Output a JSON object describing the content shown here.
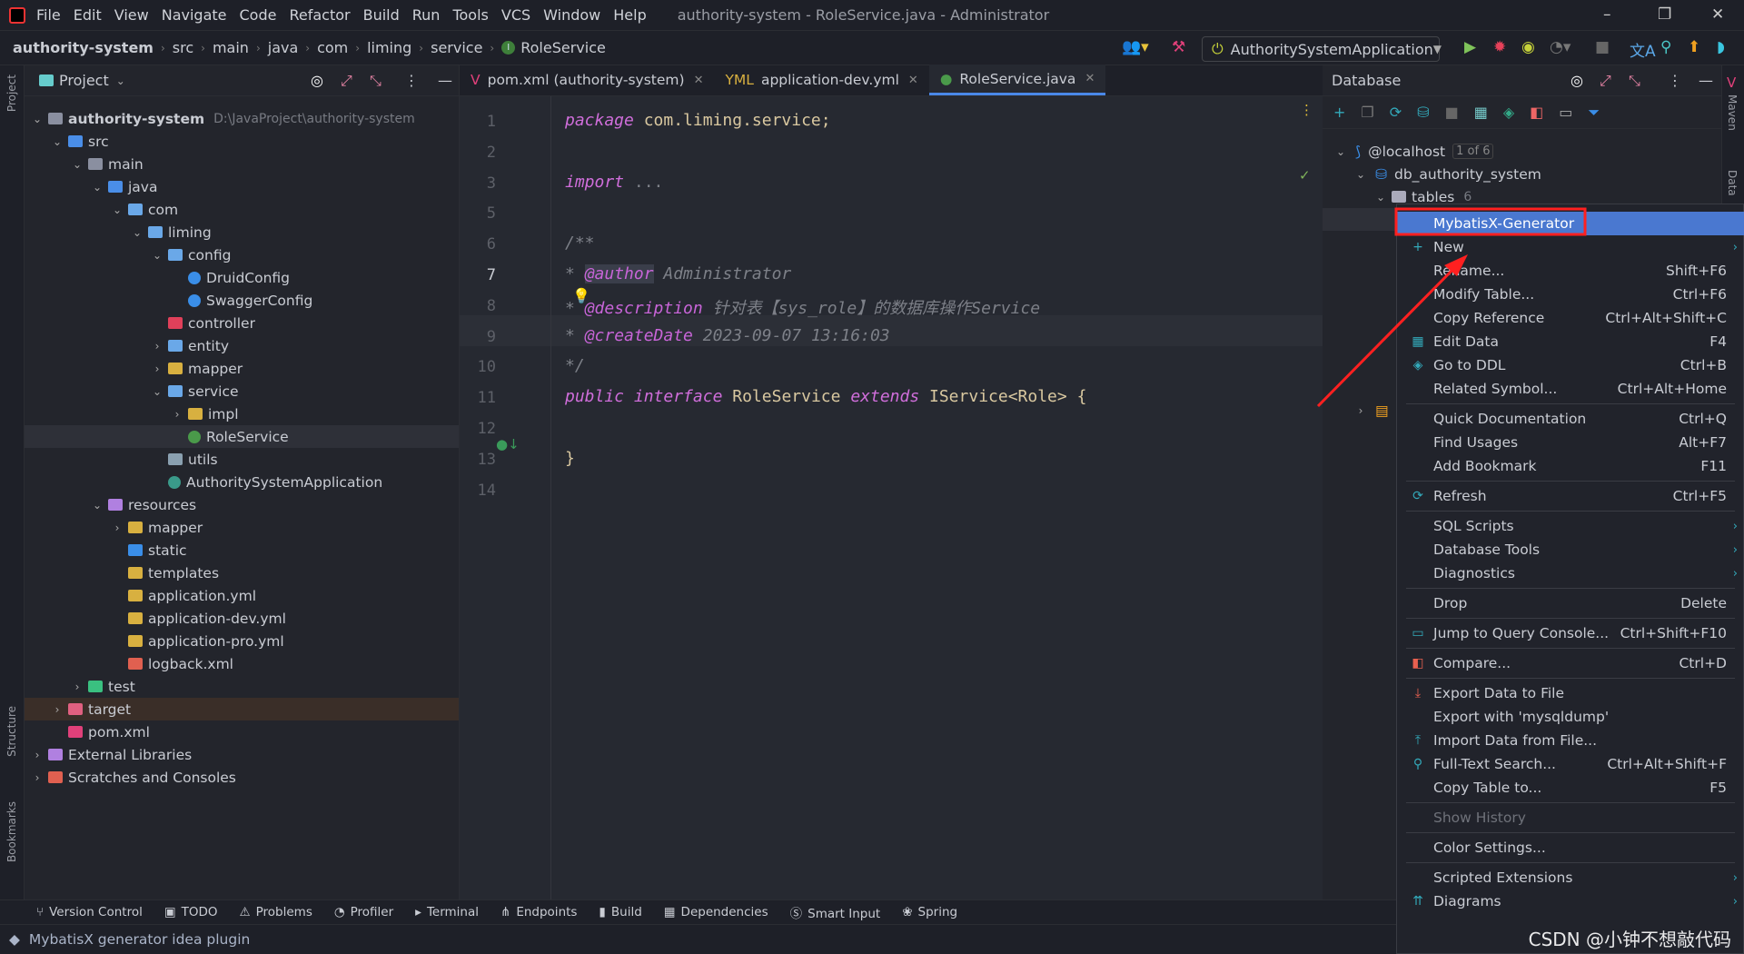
{
  "window": {
    "title": "authority-system - RoleService.java - Administrator"
  },
  "menu": [
    "File",
    "Edit",
    "View",
    "Navigate",
    "Code",
    "Refactor",
    "Build",
    "Run",
    "Tools",
    "VCS",
    "Window",
    "Help"
  ],
  "breadcrumb": [
    "authority-system",
    "src",
    "main",
    "java",
    "com",
    "liming",
    "service",
    "RoleService"
  ],
  "run_config": "AuthoritySystemApplication",
  "left_strip": [
    "Project",
    "Structure",
    "Bookmarks"
  ],
  "right_strip": [
    "Maven",
    "Data"
  ],
  "project": {
    "title": "Project",
    "tree": [
      {
        "d": 0,
        "c": "v",
        "t": "dir",
        "label": "authority-system",
        "hint": "D:\\JavaProject\\authority-system",
        "bold": true
      },
      {
        "d": 1,
        "c": "v",
        "t": "src",
        "label": "src"
      },
      {
        "d": 2,
        "c": "v",
        "t": "dir",
        "label": "main"
      },
      {
        "d": 3,
        "c": "v",
        "t": "src",
        "label": "java"
      },
      {
        "d": 4,
        "c": "v",
        "t": "pkg",
        "label": "com"
      },
      {
        "d": 5,
        "c": "v",
        "t": "pkg",
        "label": "liming"
      },
      {
        "d": 6,
        "c": "v",
        "t": "pkg",
        "label": "config"
      },
      {
        "d": 7,
        "c": "",
        "t": "class",
        "label": "DruidConfig"
      },
      {
        "d": 7,
        "c": "",
        "t": "class",
        "label": "SwaggerConfig"
      },
      {
        "d": 6,
        "c": "",
        "t": "pkgr",
        "label": "controller"
      },
      {
        "d": 6,
        "c": ">",
        "t": "pkg",
        "label": "entity"
      },
      {
        "d": 6,
        "c": ">",
        "t": "pkgy",
        "label": "mapper"
      },
      {
        "d": 6,
        "c": "v",
        "t": "pkg",
        "label": "service"
      },
      {
        "d": 7,
        "c": ">",
        "t": "pkgy",
        "label": "impl"
      },
      {
        "d": 7,
        "c": "",
        "t": "iface",
        "label": "RoleService",
        "sel": true
      },
      {
        "d": 6,
        "c": "",
        "t": "pkgg",
        "label": "utils"
      },
      {
        "d": 6,
        "c": "",
        "t": "app",
        "label": "AuthoritySystemApplication"
      },
      {
        "d": 3,
        "c": "v",
        "t": "res",
        "label": "resources"
      },
      {
        "d": 4,
        "c": ">",
        "t": "pkgy",
        "label": "mapper"
      },
      {
        "d": 4,
        "c": "",
        "t": "web",
        "label": "static"
      },
      {
        "d": 4,
        "c": "",
        "t": "pkgy",
        "label": "templates"
      },
      {
        "d": 4,
        "c": "",
        "t": "yml",
        "label": "application.yml"
      },
      {
        "d": 4,
        "c": "",
        "t": "yml",
        "label": "application-dev.yml"
      },
      {
        "d": 4,
        "c": "",
        "t": "yml",
        "label": "application-pro.yml"
      },
      {
        "d": 4,
        "c": "",
        "t": "xml",
        "label": "logback.xml"
      },
      {
        "d": 2,
        "c": ">",
        "t": "test",
        "label": "test"
      },
      {
        "d": 1,
        "c": ">",
        "t": "target",
        "label": "target",
        "tgt": true
      },
      {
        "d": 1,
        "c": "",
        "t": "pom",
        "label": "pom.xml"
      },
      {
        "d": 0,
        "c": ">",
        "t": "lib",
        "label": "External Libraries"
      },
      {
        "d": 0,
        "c": ">",
        "t": "scr",
        "label": "Scratches and Consoles"
      }
    ]
  },
  "editor": {
    "tabs": [
      {
        "label": "pom.xml (authority-system)",
        "icon": "maven-icon"
      },
      {
        "label": "application-dev.yml",
        "icon": "yaml-icon"
      },
      {
        "label": "RoleService.java",
        "icon": "interface-icon",
        "active": true
      }
    ],
    "lines": [
      {
        "n": "1",
        "seg": [
          [
            "kw",
            "package"
          ],
          [
            "pl",
            " com.liming.service;"
          ]
        ]
      },
      {
        "n": "2",
        "seg": []
      },
      {
        "n": "3",
        "seg": [
          [
            "kw",
            "import"
          ],
          [
            "fold",
            " ..."
          ]
        ]
      },
      {
        "n": "5",
        "seg": []
      },
      {
        "n": "6",
        "seg": [
          [
            "cm",
            "/**"
          ]
        ]
      },
      {
        "n": "7",
        "seg": [
          [
            "cm",
            "* "
          ],
          [
            "tag",
            "@author"
          ],
          [
            "cm",
            " Administrator"
          ]
        ]
      },
      {
        "n": "8",
        "seg": [
          [
            "cm",
            "* "
          ],
          [
            "tag",
            "@description"
          ],
          [
            "cm",
            " 针对表【sys_role】的数据库操作Service"
          ]
        ]
      },
      {
        "n": "9",
        "seg": [
          [
            "cm",
            "* "
          ],
          [
            "tag",
            "@createDate"
          ],
          [
            "cm",
            " 2023-09-07 13:16:03"
          ]
        ]
      },
      {
        "n": "10",
        "seg": [
          [
            "cm",
            "*/"
          ]
        ]
      },
      {
        "n": "11",
        "seg": [
          [
            "kw",
            "public"
          ],
          [
            "pl",
            " "
          ],
          [
            "kw",
            "interface"
          ],
          [
            "pl",
            " RoleService "
          ],
          [
            "kw",
            "extends"
          ],
          [
            "pl",
            " IService<Role> {"
          ]
        ]
      },
      {
        "n": "12",
        "seg": []
      },
      {
        "n": "13",
        "seg": [
          [
            "pl",
            "}"
          ]
        ]
      },
      {
        "n": "14",
        "seg": []
      }
    ]
  },
  "database": {
    "title": "Database",
    "host": "@localhost",
    "host_badge": "1 of 6",
    "schema": "db_authority_system",
    "tables": "tables",
    "tables_count": "6"
  },
  "context_menu": [
    {
      "label": "MybatisX-Generator",
      "hl": true
    },
    {
      "label": "New",
      "icon": "+",
      "sub": true
    },
    {
      "label": "Rename...",
      "sc": "Shift+F6"
    },
    {
      "label": "Modify Table...",
      "sc": "Ctrl+F6"
    },
    {
      "label": "Copy Reference",
      "sc": "Ctrl+Alt+Shift+C"
    },
    {
      "label": "Edit Data",
      "sc": "F4",
      "icon": "▦"
    },
    {
      "label": "Go to DDL",
      "sc": "Ctrl+B",
      "icon": "◈"
    },
    {
      "label": "Related Symbol...",
      "sc": "Ctrl+Alt+Home"
    },
    {
      "sep": true
    },
    {
      "label": "Quick Documentation",
      "sc": "Ctrl+Q"
    },
    {
      "label": "Find Usages",
      "sc": "Alt+F7"
    },
    {
      "label": "Add Bookmark",
      "sc": "F11"
    },
    {
      "sep": true
    },
    {
      "label": "Refresh",
      "sc": "Ctrl+F5",
      "icon": "⟳"
    },
    {
      "sep": true
    },
    {
      "label": "SQL Scripts",
      "sub": true
    },
    {
      "label": "Database Tools",
      "sub": true
    },
    {
      "label": "Diagnostics",
      "sub": true
    },
    {
      "sep": true
    },
    {
      "label": "Drop",
      "sc": "Delete"
    },
    {
      "sep": true
    },
    {
      "label": "Jump to Query Console...",
      "sc": "Ctrl+Shift+F10",
      "icon": "▭"
    },
    {
      "sep": true
    },
    {
      "label": "Compare...",
      "sc": "Ctrl+D",
      "icon": "◧"
    },
    {
      "sep": true
    },
    {
      "label": "Export Data to File",
      "icon": "⤓"
    },
    {
      "label": "Export with 'mysqldump'"
    },
    {
      "label": "Import Data from File...",
      "icon": "⤒"
    },
    {
      "label": "Full-Text Search...",
      "sc": "Ctrl+Alt+Shift+F",
      "icon": "⚲"
    },
    {
      "label": "Copy Table to...",
      "sc": "F5"
    },
    {
      "sep": true
    },
    {
      "label": "Show History",
      "dis": true
    },
    {
      "sep": true
    },
    {
      "label": "Color Settings..."
    },
    {
      "sep": true
    },
    {
      "label": "Scripted Extensions",
      "sub": true
    },
    {
      "label": "Diagrams",
      "sub": true,
      "icon": "⇈"
    }
  ],
  "tool_tabs": [
    {
      "label": "Version Control",
      "icon": "⑂"
    },
    {
      "label": "TODO",
      "icon": "▣"
    },
    {
      "label": "Problems",
      "icon": "⚠"
    },
    {
      "label": "Profiler",
      "icon": "◔"
    },
    {
      "label": "Terminal",
      "icon": "▸"
    },
    {
      "label": "Endpoints",
      "icon": "⋔"
    },
    {
      "label": "Build",
      "icon": "▮"
    },
    {
      "label": "Dependencies",
      "icon": "▦"
    },
    {
      "label": "Smart Input",
      "icon": "Ⓢ"
    },
    {
      "label": "Spring",
      "icon": "❀"
    }
  ],
  "status": "MybatisX generator idea plugin",
  "watermark": "CSDN @小钟不想敲代码",
  "colors": {
    "accent": "#4a78d0",
    "annotation": "#ff2020"
  }
}
